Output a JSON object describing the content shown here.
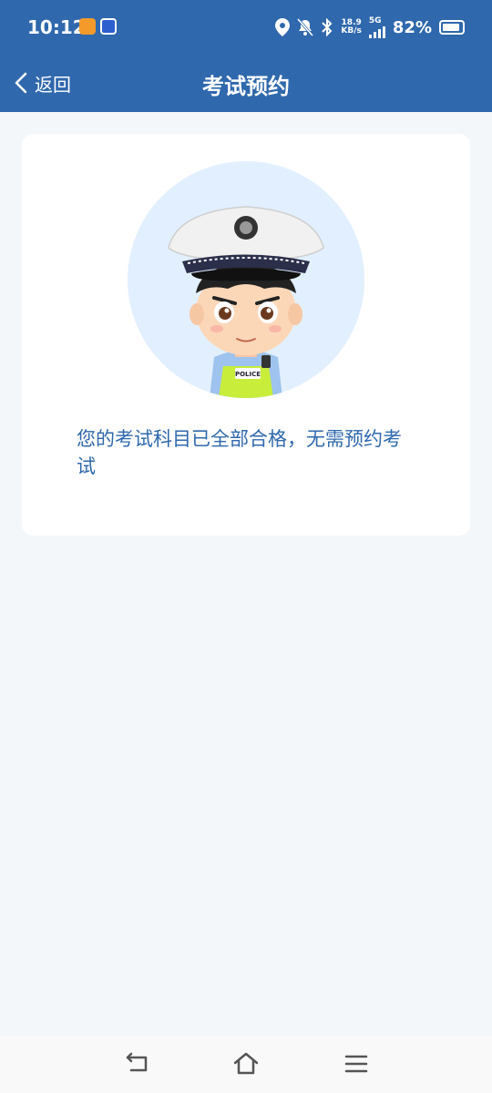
{
  "status_bar": {
    "time": "10:12",
    "net_speed_value": "18.9",
    "net_speed_unit": "KB/s",
    "network_type": "5G",
    "battery": "82%"
  },
  "nav": {
    "back_label": "返回",
    "title": "考试预约"
  },
  "card": {
    "message": "您的考试科目已全部合格，无需预约考试"
  },
  "avatar": {
    "badge_text": "POLICE"
  },
  "colors": {
    "header_bg": "#2f68ad",
    "page_bg": "#f3f7fa",
    "message_text": "#2f68ad",
    "avatar_bg": "#e2efff"
  },
  "icons": {
    "back": "chevron-left-icon",
    "location": "location-icon",
    "mute": "bell-off-icon",
    "bluetooth": "bluetooth-icon",
    "signal": "signal-icon",
    "battery": "battery-icon",
    "nav_back": "back-arrow-icon",
    "nav_home": "home-icon",
    "nav_menu": "menu-icon"
  }
}
